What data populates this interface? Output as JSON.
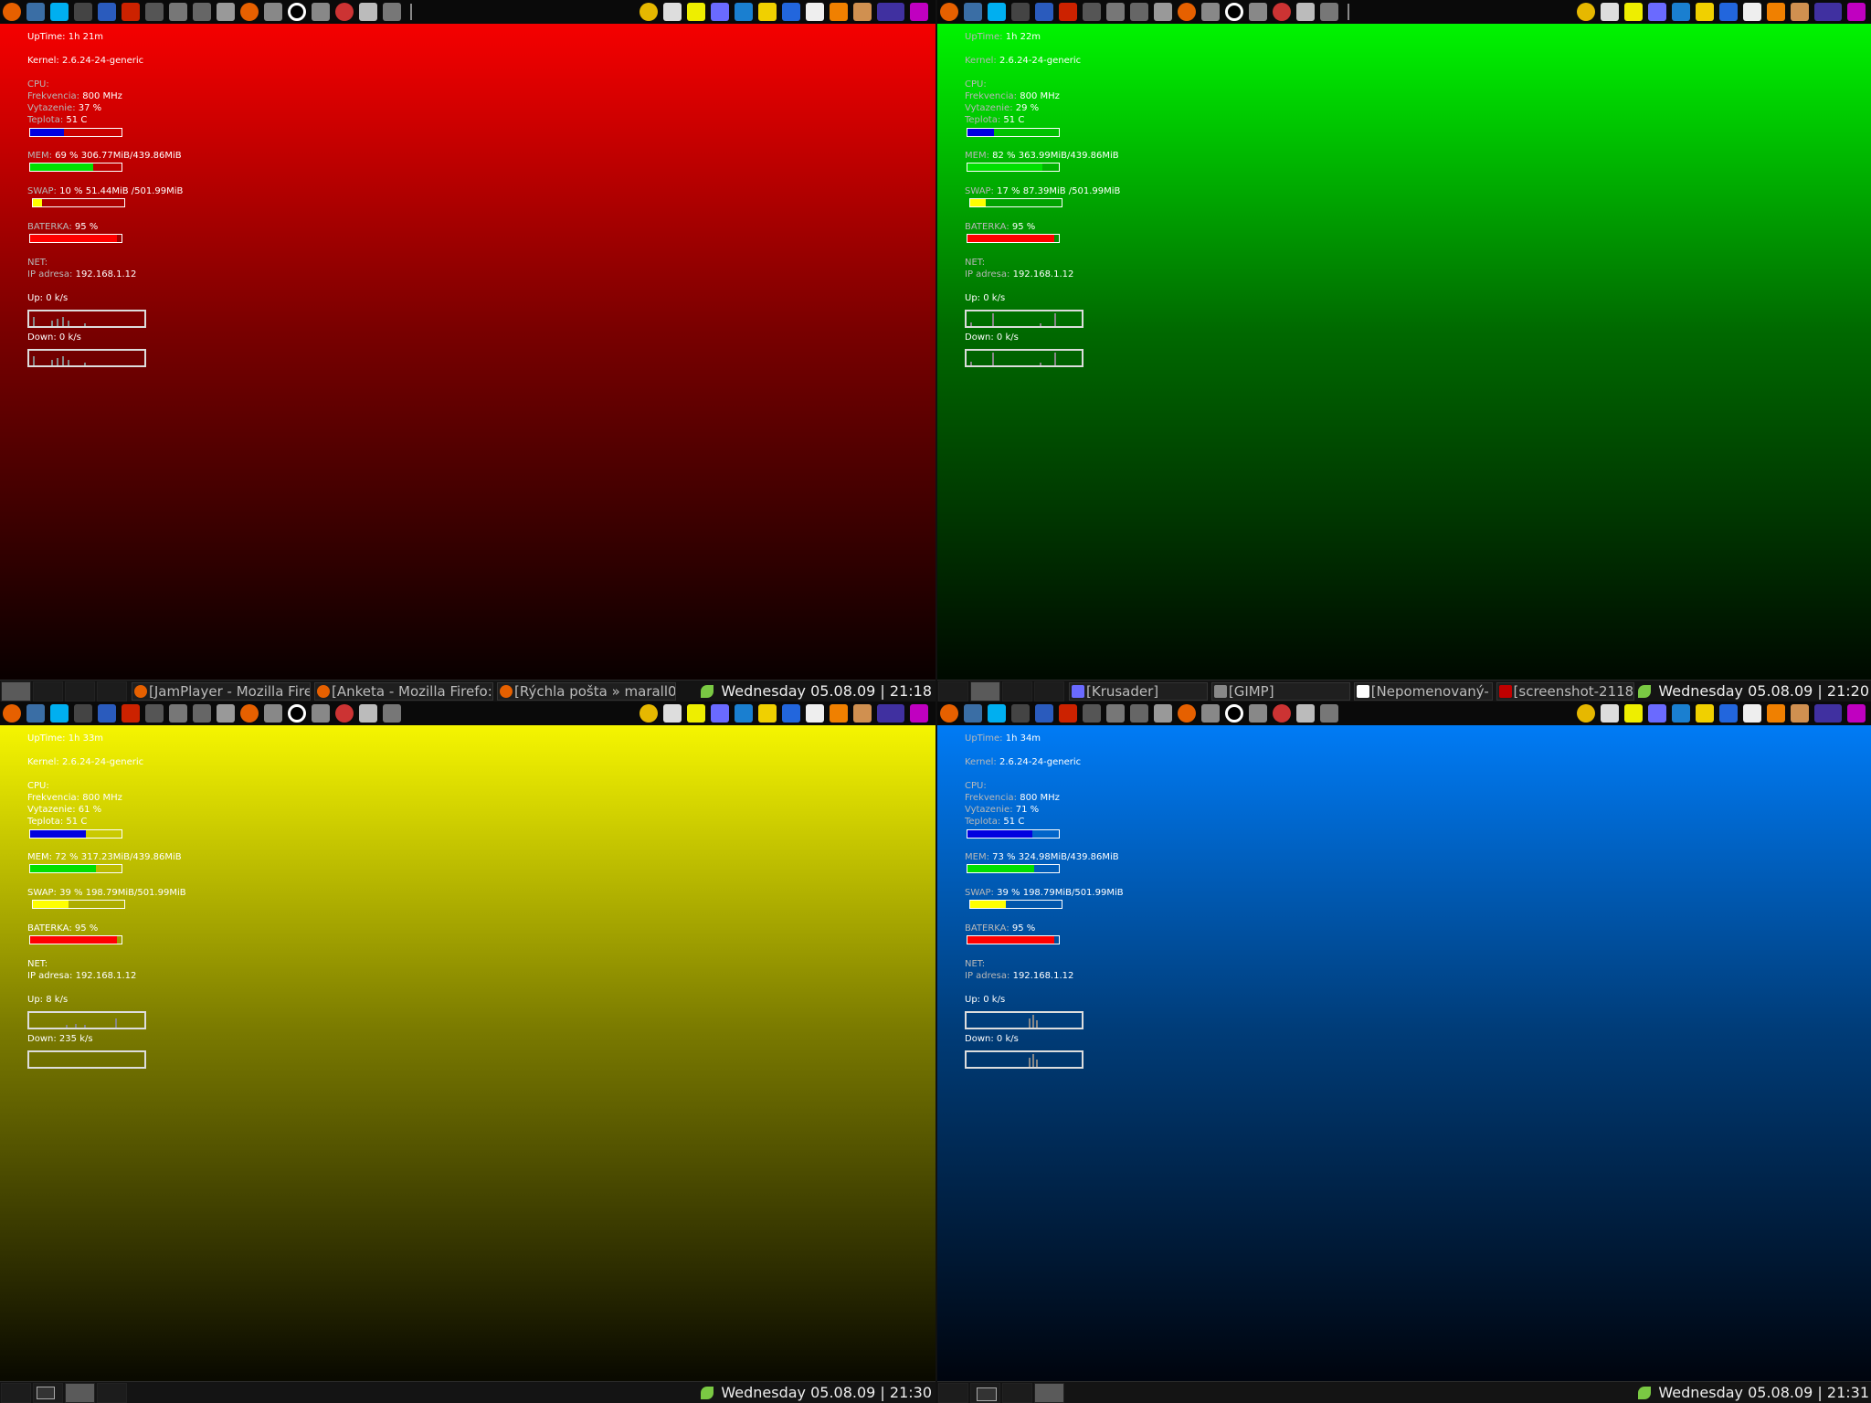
{
  "launcher_icons": [
    "firefox-icon",
    "files-icon",
    "skype-icon",
    "terminal-icon",
    "editor-icon",
    "book-icon",
    "calculator-icon",
    "scanner-icon",
    "tools-icon",
    "window-icon",
    "firefox-icon",
    "keyboard-icon",
    "circle-icon",
    "keyboard-icon",
    "network-icon",
    "image-icon",
    "pen-icon"
  ],
  "tray_icons": [
    "media-icon",
    "clipboard-icon",
    "qq-icon",
    "monitor-icon",
    "cool-icon",
    "refresh-icon",
    "s-icon",
    "music-note-icon",
    "vlc-icon",
    "app-icon",
    "rbs-icon",
    "p-icon"
  ],
  "labels": {
    "uptime": "UpTime:",
    "kernel": "Kernel:",
    "cpu": "CPU:",
    "freq": "Frekvencia:",
    "load": "Vytazenie:",
    "temp": "Teplota:",
    "mem": "MEM:",
    "swap": "SWAP:",
    "battery": "BATERKA:",
    "net": "NET:",
    "ip": "IP adresa:",
    "up": "Up:",
    "down": "Down:",
    "unit": "k/s"
  },
  "desktops": [
    {
      "color": "#ff0000",
      "conky": {
        "uptime": "1h 21m",
        "kernel": "2.6.24-24-generic",
        "freq": "800 MHz",
        "load": "37 %",
        "load_frac": 0.37,
        "temp": "51  C",
        "mem": "69 % 306.77MiB/439.86MiB",
        "mem_frac": 0.69,
        "swap": "10 % 51.44MiB /501.99MiB",
        "swap_frac": 0.1,
        "battery": "95 %",
        "battery_frac": 0.95,
        "ip": "192.168.1.12",
        "up": "0",
        "down": "0"
      },
      "tasks": [
        "[JamPlayer - Mozilla Fire",
        "[Anketa - Mozilla Firefo:",
        "[Rýchla pošta » marall0"
      ],
      "clock": "Wednesday 05.08.09 | 21:18"
    },
    {
      "color": "#00ff00",
      "conky": {
        "uptime": "1h 22m",
        "kernel": "2.6.24-24-generic",
        "freq": "800 MHz",
        "load": "29 %",
        "load_frac": 0.29,
        "temp": "51  C",
        "mem": "82 % 363.99MiB/439.86MiB",
        "mem_frac": 0.82,
        "swap": "17 % 87.39MiB /501.99MiB",
        "swap_frac": 0.17,
        "battery": "95 %",
        "battery_frac": 0.95,
        "ip": "192.168.1.12",
        "up": "0",
        "down": "0"
      },
      "tasks": [
        "[Krusader]",
        "[GIMP]",
        "[Nepomenovaný-",
        "[screenshot-2118"
      ],
      "clock": "Wednesday 05.08.09 | 21:20"
    },
    {
      "color": "#ffff00",
      "conky": {
        "uptime": "1h 33m",
        "kernel": "2.6.24-24-generic",
        "freq": "800 MHz",
        "load": "61 %",
        "load_frac": 0.61,
        "temp": "51  C",
        "mem": "72 % 317.23MiB/439.86MiB",
        "mem_frac": 0.72,
        "swap": "39 % 198.79MiB/501.99MiB",
        "swap_frac": 0.39,
        "battery": "95 %",
        "battery_frac": 0.95,
        "ip": "192.168.1.12",
        "up": "8",
        "down": "235"
      },
      "tasks": [],
      "clock": "Wednesday 05.08.09 | 21:30"
    },
    {
      "color": "#0080ff",
      "conky": {
        "uptime": "1h 34m",
        "kernel": "2.6.24-24-generic",
        "freq": "800 MHz",
        "load": "71 %",
        "load_frac": 0.71,
        "temp": "51  C",
        "mem": "73 % 324.98MiB/439.86MiB",
        "mem_frac": 0.73,
        "swap": "39 % 198.79MiB/501.99MiB",
        "swap_frac": 0.39,
        "battery": "95 %",
        "battery_frac": 0.95,
        "ip": "192.168.1.12",
        "up": "0",
        "down": "0"
      },
      "tasks": [],
      "clock": "Wednesday 05.08.09 | 21:31"
    }
  ]
}
